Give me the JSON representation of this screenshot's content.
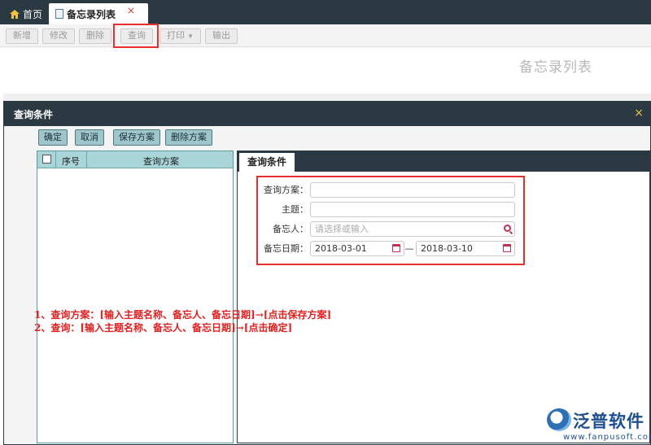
{
  "tabs": {
    "home": "首页",
    "active": "备忘录列表",
    "close": "×"
  },
  "toolbar": {
    "add": "新增",
    "edit": "修改",
    "delete": "删除",
    "query": "查询",
    "print": "打印",
    "export": "输出"
  },
  "page_title": "备忘录列表",
  "dialog": {
    "title": "查询条件",
    "close": "×",
    "buttons": {
      "confirm": "确定",
      "cancel": "取消",
      "save_scheme": "保存方案",
      "delete_scheme": "删除方案"
    },
    "left_table": {
      "col_index": "序号",
      "col_scheme": "查询方案"
    },
    "right_tab": "查询条件",
    "form": {
      "scheme_label": "查询方案：",
      "scheme_value": "",
      "subject_label": "主题：",
      "subject_value": "",
      "person_label": "备忘人：",
      "person_placeholder": "请选择或输入",
      "date_label": "备忘日期：",
      "date_from": "2018-03-01",
      "date_sep": "—",
      "date_to": "2018-03-10"
    }
  },
  "annotations": {
    "line1": "1、查询方案：[输入主题名称、备忘人、备忘日期]→[点击保存方案]",
    "line2": "2、查询：[输入主题名称、备忘人、备忘日期]→[点击确定]"
  },
  "logo": {
    "name": "泛普软件",
    "url": "www.fanpusoft.com"
  },
  "colors": {
    "dark": "#2b3a42",
    "highlight": "#e53030",
    "teal": "#a9d4d8"
  }
}
